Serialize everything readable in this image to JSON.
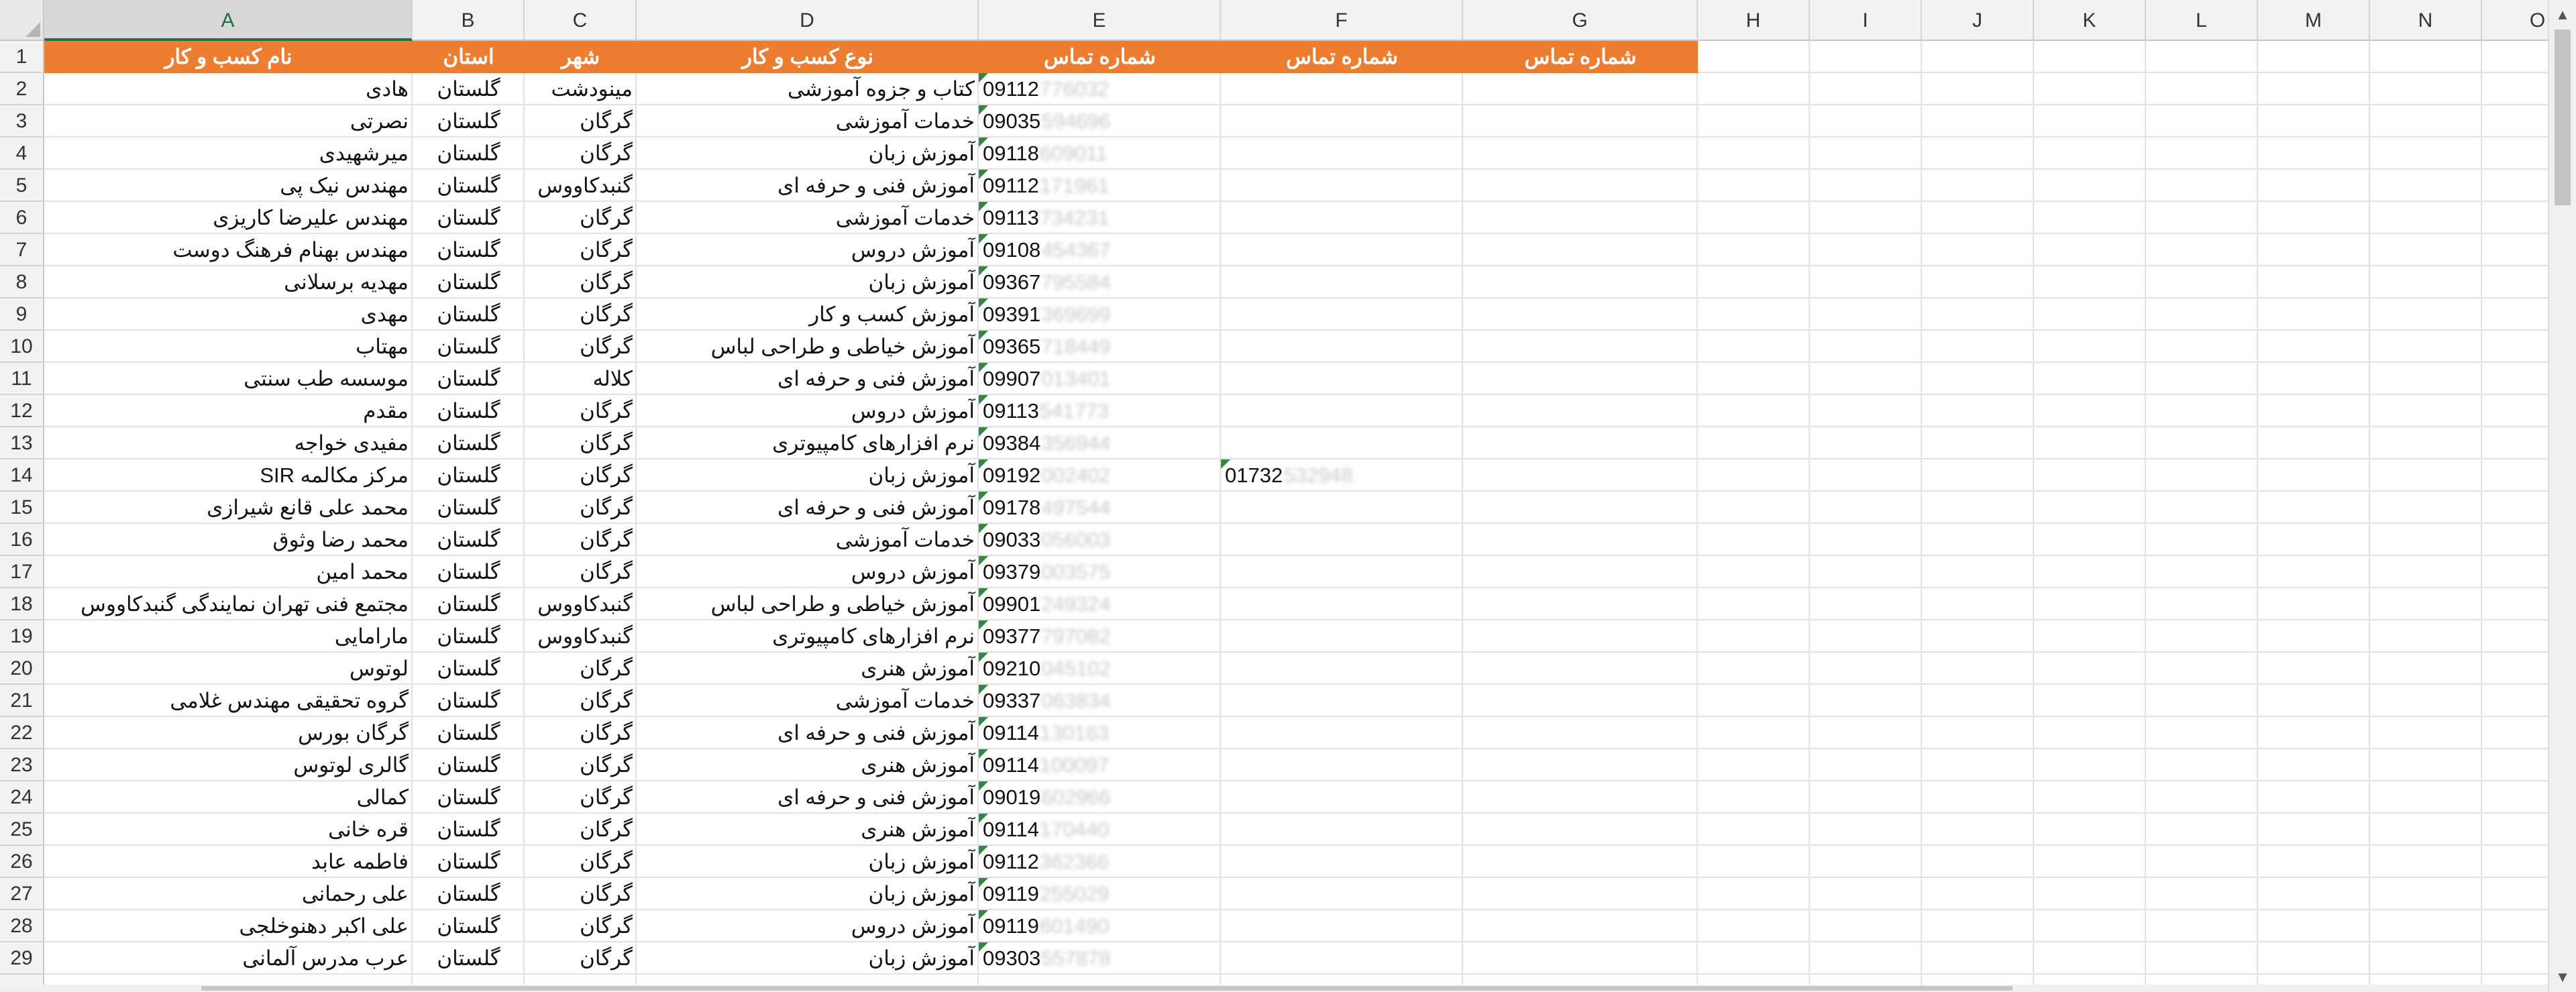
{
  "sheet": {
    "column_letters": [
      "A",
      "B",
      "C",
      "D",
      "E",
      "F",
      "G",
      "H",
      "I",
      "J",
      "K",
      "L",
      "M",
      "N",
      "O"
    ],
    "selected_column": "A",
    "header_row": {
      "number": "1",
      "name_label": "نام کسب و کار",
      "province_label": "استان",
      "city_label": "شهر",
      "type_label": "نوع کسب و کار",
      "phone_label_e": "شماره تماس",
      "phone_label_f": "شماره تماس",
      "phone_label_g": "شماره تماس"
    },
    "rows": [
      {
        "num": "2",
        "name": "هادی",
        "province": "گلستان",
        "city": "مینودشت",
        "type": "کتاب و جزوه آموزشی",
        "phone_prefix": "09112",
        "phone_hidden": "776032",
        "phone2_prefix": "",
        "phone2_hidden": ""
      },
      {
        "num": "3",
        "name": "نصرتی",
        "province": "گلستان",
        "city": "گرگان",
        "type": "خدمات آموزشی",
        "phone_prefix": "09035",
        "phone_hidden": "594696",
        "phone2_prefix": "",
        "phone2_hidden": ""
      },
      {
        "num": "4",
        "name": "میرشهیدی",
        "province": "گلستان",
        "city": "گرگان",
        "type": "آموزش زبان",
        "phone_prefix": "09118",
        "phone_hidden": "609011",
        "phone2_prefix": "",
        "phone2_hidden": ""
      },
      {
        "num": "5",
        "name": "مهندس نیک پی",
        "province": "گلستان",
        "city": "گنبدکاووس",
        "type": "آموزش فنی و حرفه ای",
        "phone_prefix": "09112",
        "phone_hidden": "171961",
        "phone2_prefix": "",
        "phone2_hidden": ""
      },
      {
        "num": "6",
        "name": "مهندس علیرضا کاریزی",
        "province": "گلستان",
        "city": "گرگان",
        "type": "خدمات آموزشی",
        "phone_prefix": "09113",
        "phone_hidden": "734231",
        "phone2_prefix": "",
        "phone2_hidden": ""
      },
      {
        "num": "7",
        "name": "مهندس بهنام فرهنگ دوست",
        "province": "گلستان",
        "city": "گرگان",
        "type": "آموزش دروس",
        "phone_prefix": "09108",
        "phone_hidden": "454367",
        "phone2_prefix": "",
        "phone2_hidden": ""
      },
      {
        "num": "8",
        "name": "مهدیه برسلانی",
        "province": "گلستان",
        "city": "گرگان",
        "type": "آموزش زبان",
        "phone_prefix": "09367",
        "phone_hidden": "795584",
        "phone2_prefix": "",
        "phone2_hidden": ""
      },
      {
        "num": "9",
        "name": "مهدی",
        "province": "گلستان",
        "city": "گرگان",
        "type": "آموزش کسب و کار",
        "phone_prefix": "09391",
        "phone_hidden": "369699",
        "phone2_prefix": "",
        "phone2_hidden": ""
      },
      {
        "num": "10",
        "name": "مهتاب",
        "province": "گلستان",
        "city": "گرگان",
        "type": "آموزش خیاطی و طراحی لباس",
        "phone_prefix": "09365",
        "phone_hidden": "718449",
        "phone2_prefix": "",
        "phone2_hidden": ""
      },
      {
        "num": "11",
        "name": "موسسه طب سنتی",
        "province": "گلستان",
        "city": "کلاله",
        "type": "آموزش فنی و حرفه ای",
        "phone_prefix": "09907",
        "phone_hidden": "013401",
        "phone2_prefix": "",
        "phone2_hidden": ""
      },
      {
        "num": "12",
        "name": "مقدم",
        "province": "گلستان",
        "city": "گرگان",
        "type": "آموزش دروس",
        "phone_prefix": "09113",
        "phone_hidden": "541773",
        "phone2_prefix": "",
        "phone2_hidden": ""
      },
      {
        "num": "13",
        "name": "مفیدی خواجه",
        "province": "گلستان",
        "city": "گرگان",
        "type": "نرم افزارهای کامپیوتری",
        "phone_prefix": "09384",
        "phone_hidden": "356944",
        "phone2_prefix": "",
        "phone2_hidden": ""
      },
      {
        "num": "14",
        "name": "مرکز مکالمه SIR",
        "province": "گلستان",
        "city": "گرگان",
        "type": "آموزش زبان",
        "phone_prefix": "09192",
        "phone_hidden": "002402",
        "phone2_prefix": "01732",
        "phone2_hidden": "532948"
      },
      {
        "num": "15",
        "name": "محمد علی قانع شیرازی",
        "province": "گلستان",
        "city": "گرگان",
        "type": "آموزش فنی و حرفه ای",
        "phone_prefix": "09178",
        "phone_hidden": "497544",
        "phone2_prefix": "",
        "phone2_hidden": ""
      },
      {
        "num": "16",
        "name": "محمد رضا وثوق",
        "province": "گلستان",
        "city": "گرگان",
        "type": "خدمات آموزشی",
        "phone_prefix": "09033",
        "phone_hidden": "056003",
        "phone2_prefix": "",
        "phone2_hidden": ""
      },
      {
        "num": "17",
        "name": "محمد امین",
        "province": "گلستان",
        "city": "گرگان",
        "type": "آموزش دروس",
        "phone_prefix": "09379",
        "phone_hidden": "003575",
        "phone2_prefix": "",
        "phone2_hidden": ""
      },
      {
        "num": "18",
        "name": "مجتمع فنی تهران نمایندگی گنبدکاووس",
        "province": "گلستان",
        "city": "گنبدکاووس",
        "type": "آموزش خیاطی و طراحی لباس",
        "phone_prefix": "09901",
        "phone_hidden": "249324",
        "phone2_prefix": "",
        "phone2_hidden": ""
      },
      {
        "num": "19",
        "name": "مارامایی",
        "province": "گلستان",
        "city": "گنبدکاووس",
        "type": "نرم افزارهای کامپیوتری",
        "phone_prefix": "09377",
        "phone_hidden": "797082",
        "phone2_prefix": "",
        "phone2_hidden": ""
      },
      {
        "num": "20",
        "name": "لوتوس",
        "province": "گلستان",
        "city": "گرگان",
        "type": "آموزش هنری",
        "phone_prefix": "09210",
        "phone_hidden": "045102",
        "phone2_prefix": "",
        "phone2_hidden": ""
      },
      {
        "num": "21",
        "name": "گروه تحقیقی مهندس غلامی",
        "province": "گلستان",
        "city": "گرگان",
        "type": "خدمات آموزشی",
        "phone_prefix": "09337",
        "phone_hidden": "063834",
        "phone2_prefix": "",
        "phone2_hidden": ""
      },
      {
        "num": "22",
        "name": "گرگان بورس",
        "province": "گلستان",
        "city": "گرگان",
        "type": "آموزش فنی و حرفه ای",
        "phone_prefix": "09114",
        "phone_hidden": "130163",
        "phone2_prefix": "",
        "phone2_hidden": ""
      },
      {
        "num": "23",
        "name": "گالری لوتوس",
        "province": "گلستان",
        "city": "گرگان",
        "type": "آموزش هنری",
        "phone_prefix": "09114",
        "phone_hidden": "100097",
        "phone2_prefix": "",
        "phone2_hidden": ""
      },
      {
        "num": "24",
        "name": "کمالی",
        "province": "گلستان",
        "city": "گرگان",
        "type": "آموزش فنی و حرفه ای",
        "phone_prefix": "09019",
        "phone_hidden": "602966",
        "phone2_prefix": "",
        "phone2_hidden": ""
      },
      {
        "num": "25",
        "name": "قره خانی",
        "province": "گلستان",
        "city": "گرگان",
        "type": "آموزش هنری",
        "phone_prefix": "09114",
        "phone_hidden": "170440",
        "phone2_prefix": "",
        "phone2_hidden": ""
      },
      {
        "num": "26",
        "name": "فاطمه عابد",
        "province": "گلستان",
        "city": "گرگان",
        "type": "آموزش زبان",
        "phone_prefix": "09112",
        "phone_hidden": "362366",
        "phone2_prefix": "",
        "phone2_hidden": ""
      },
      {
        "num": "27",
        "name": "علی رحمانی",
        "province": "گلستان",
        "city": "گرگان",
        "type": "آموزش زبان",
        "phone_prefix": "09119",
        "phone_hidden": "255029",
        "phone2_prefix": "",
        "phone2_hidden": ""
      },
      {
        "num": "28",
        "name": "علی اکبر دهنوخلجی",
        "province": "گلستان",
        "city": "گرگان",
        "type": "آموزش دروس",
        "phone_prefix": "09119",
        "phone_hidden": "601490",
        "phone2_prefix": "",
        "phone2_hidden": ""
      },
      {
        "num": "29",
        "name": "عرب  مدرس آلمانی",
        "province": "گلستان",
        "city": "گرگان",
        "type": "آموزش زبان",
        "phone_prefix": "09303",
        "phone_hidden": "557878",
        "phone2_prefix": "",
        "phone2_hidden": ""
      }
    ]
  },
  "colors": {
    "header_fill": "#ed7d31",
    "header_text": "#ffffff",
    "selection": "#217346",
    "error_triangle": "#2e8b3e"
  },
  "icons": {
    "scroll_up": "triangle-up",
    "scroll_down": "triangle-down"
  }
}
